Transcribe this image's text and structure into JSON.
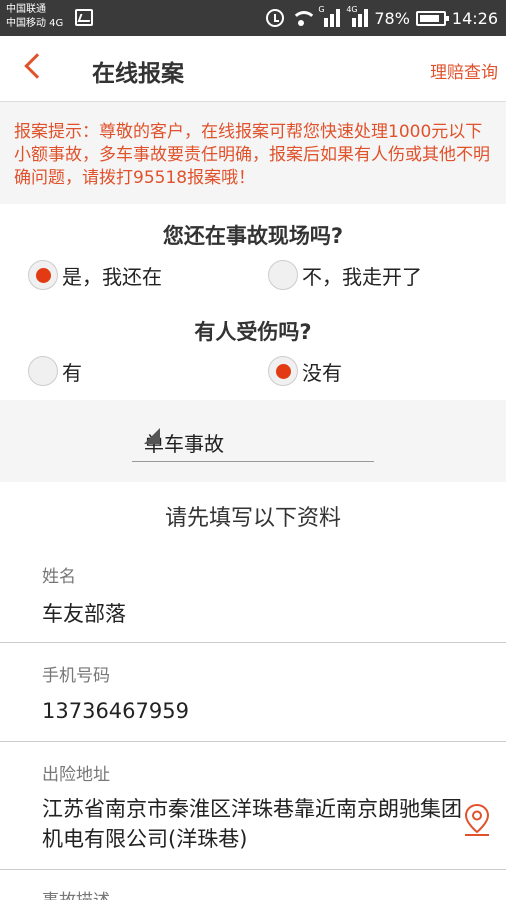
{
  "status_bar": {
    "carrier_1": "中国联通",
    "carrier_2": "中国移动 4G",
    "net_g": "G",
    "net_4g": "4G",
    "battery": "78%",
    "time": "14:26"
  },
  "nav": {
    "title": "在线报案",
    "claim_query": "理赔查询"
  },
  "notice": {
    "text": "报案提示：尊敬的客户，在线报案可帮您快速处理1000元以下小额事故，多车事故要责任明确，报案后如果有人伤或其他不明确问题，请拨打95518报案哦！"
  },
  "questions": [
    {
      "title": "您还在事故现场吗?",
      "options": [
        {
          "label": "是，我还在",
          "checked": true
        },
        {
          "label": "不，我走开了",
          "checked": false
        }
      ]
    },
    {
      "title": "有人受伤吗?",
      "options": [
        {
          "label": "有",
          "checked": false
        },
        {
          "label": "没有",
          "checked": true
        }
      ]
    }
  ],
  "accident_type": {
    "selected": "单车事故"
  },
  "form": {
    "header": "请先填写以下资料",
    "name": {
      "label": "姓名",
      "value": "车友部落"
    },
    "phone": {
      "label": "手机号码",
      "value": "13736467959"
    },
    "address": {
      "label": "出险地址",
      "value": "江苏省南京市秦淮区洋珠巷靠近南京朗驰集团机电有限公司(洋珠巷)"
    },
    "description": {
      "label": "事故描述"
    }
  },
  "colors": {
    "accent": "#e0522c",
    "radio_checked": "#e23a12",
    "status_bar": "#3a3a3a"
  }
}
